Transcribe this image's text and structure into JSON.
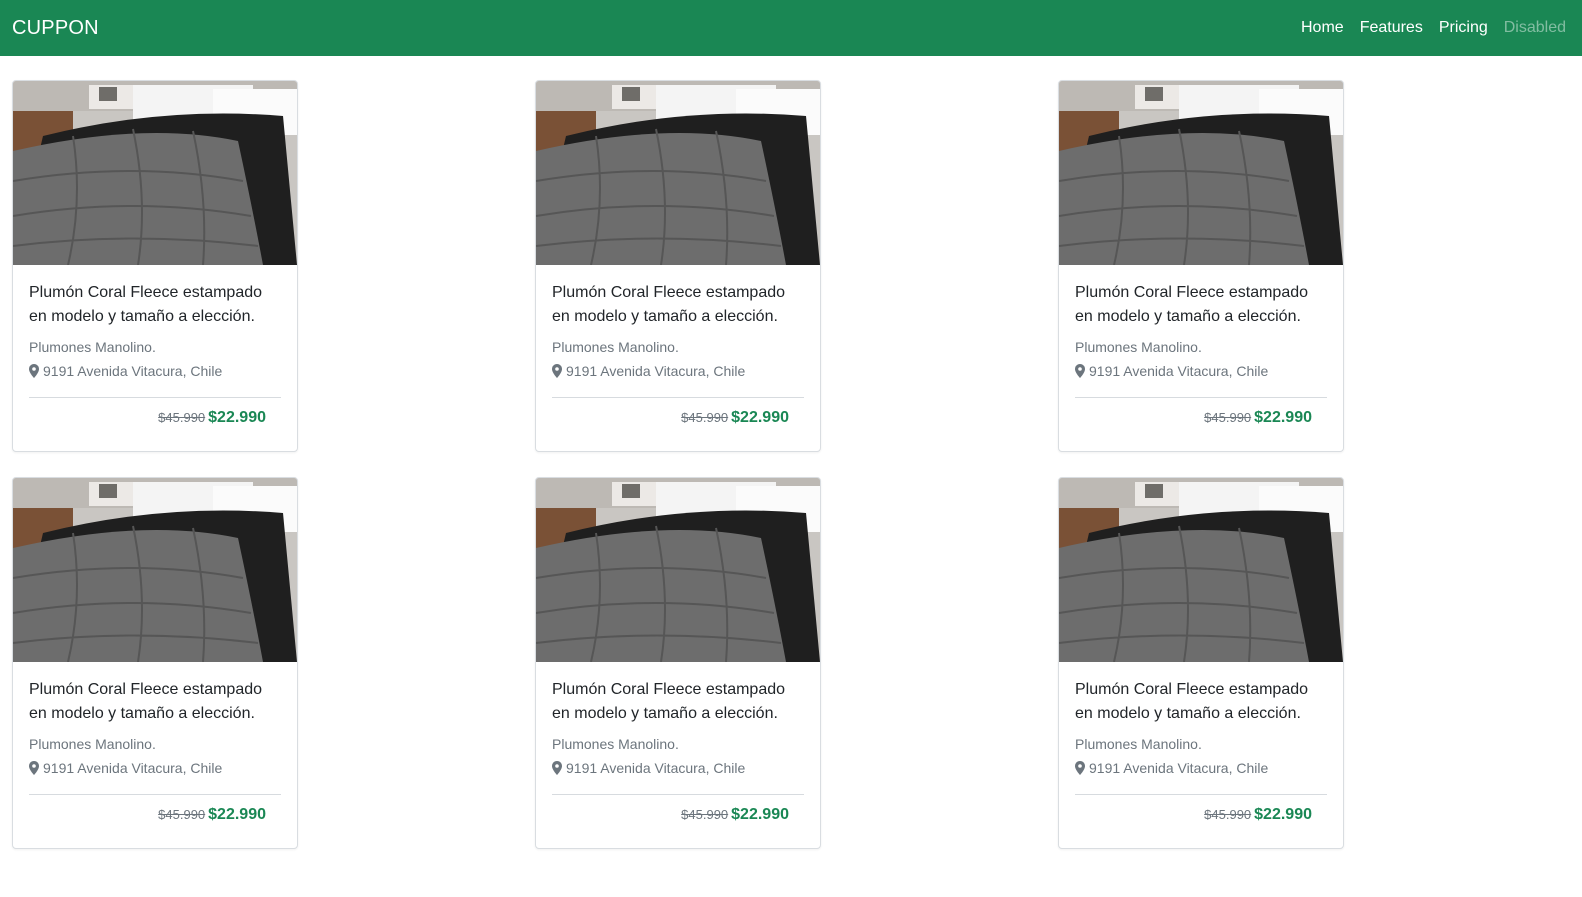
{
  "navbar": {
    "brand": "CUPPON",
    "links": [
      {
        "label": "Home"
      },
      {
        "label": "Features"
      },
      {
        "label": "Pricing"
      },
      {
        "label": "Disabled"
      }
    ]
  },
  "cards": [
    {
      "title": "Plumón Coral Fleece estampado en modelo y tamaño a elección.",
      "seller": "Plumones Manolino.",
      "address": "9191 Avenida Vitacura, Chile",
      "old_price": "$45.990",
      "new_price": "$22.990"
    },
    {
      "title": "Plumón Coral Fleece estampado en modelo y tamaño a elección.",
      "seller": "Plumones Manolino.",
      "address": "9191 Avenida Vitacura, Chile",
      "old_price": "$45.990",
      "new_price": "$22.990"
    },
    {
      "title": "Plumón Coral Fleece estampado en modelo y tamaño a elección.",
      "seller": "Plumones Manolino.",
      "address": "9191 Avenida Vitacura, Chile",
      "old_price": "$45.990",
      "new_price": "$22.990"
    },
    {
      "title": "Plumón Coral Fleece estampado en modelo y tamaño a elección.",
      "seller": "Plumones Manolino.",
      "address": "9191 Avenida Vitacura, Chile",
      "old_price": "$45.990",
      "new_price": "$22.990"
    },
    {
      "title": "Plumón Coral Fleece estampado en modelo y tamaño a elección.",
      "seller": "Plumones Manolino.",
      "address": "9191 Avenida Vitacura, Chile",
      "old_price": "$45.990",
      "new_price": "$22.990"
    },
    {
      "title": "Plumón Coral Fleece estampado en modelo y tamaño a elección.",
      "seller": "Plumones Manolino.",
      "address": "9191 Avenida Vitacura, Chile",
      "old_price": "$45.990",
      "new_price": "$22.990"
    }
  ],
  "colors": {
    "navbar_bg": "#1a8754",
    "price_green": "#1a8754",
    "muted_text": "#6c757d"
  },
  "icons": {
    "location": "map-marker-icon"
  }
}
